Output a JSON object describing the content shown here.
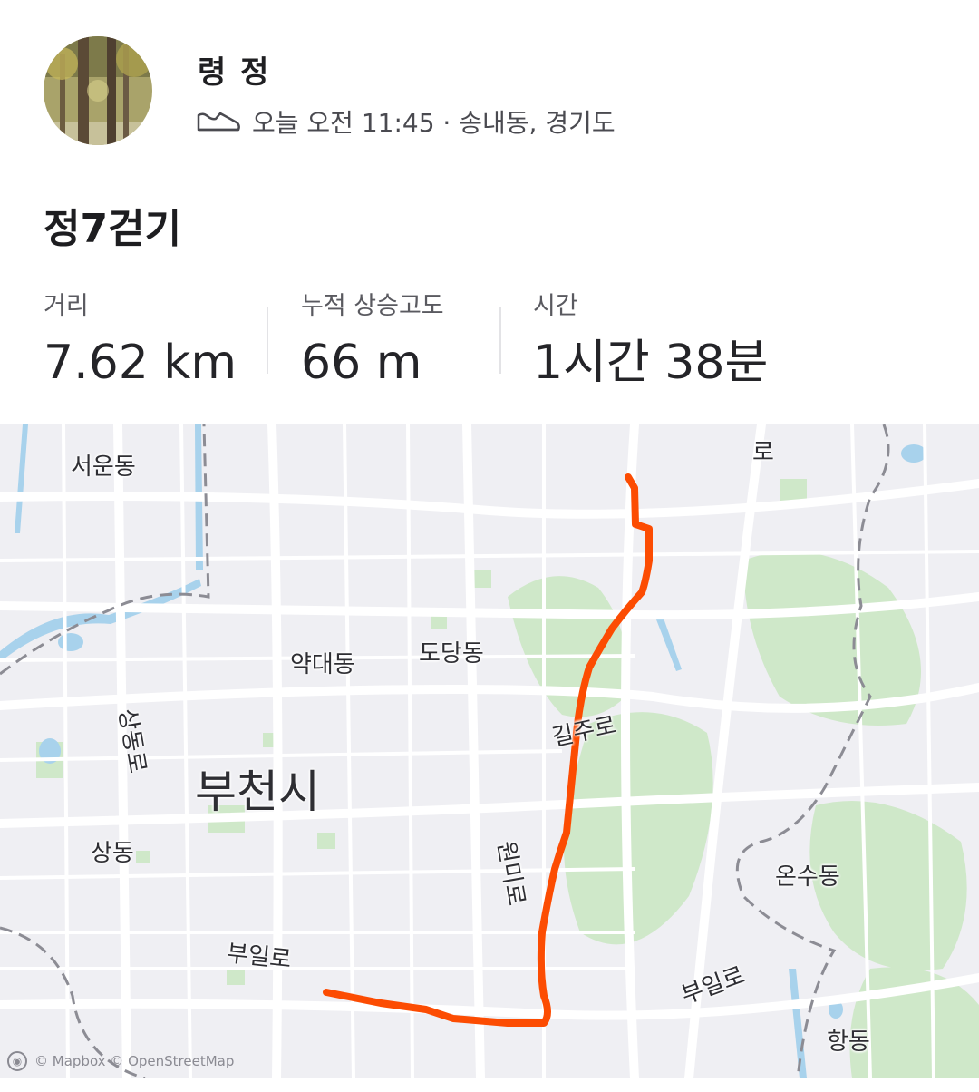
{
  "activity": {
    "athlete_name": "령 정",
    "activity_icon": "shoe-icon",
    "meta_text": "오늘 오전 11:45 · 송내동, 경기도",
    "title": "정7걷기"
  },
  "stats": [
    {
      "label": "거리",
      "value": "7.62 km"
    },
    {
      "label": "누적 상승고도",
      "value": "66 m"
    },
    {
      "label": "시간",
      "value": "1시간 38분"
    }
  ],
  "map": {
    "route_color": "#fc4c02",
    "labels": {
      "seoun": "서운동",
      "yakdae": "약대동",
      "dodang": "도당동",
      "sangdong_ro": "상동로",
      "gilju_ro": "길주로",
      "bucheon_si": "부천시",
      "wonmi_ro": "원미로",
      "sangdong": "상동",
      "onsu": "온수동",
      "buil_ro_1": "부일로",
      "buil_ro_2": "부일로",
      "hangdong": "항동",
      "ro_top": "로"
    },
    "attribution": "© Mapbox © OpenStreetMap"
  }
}
